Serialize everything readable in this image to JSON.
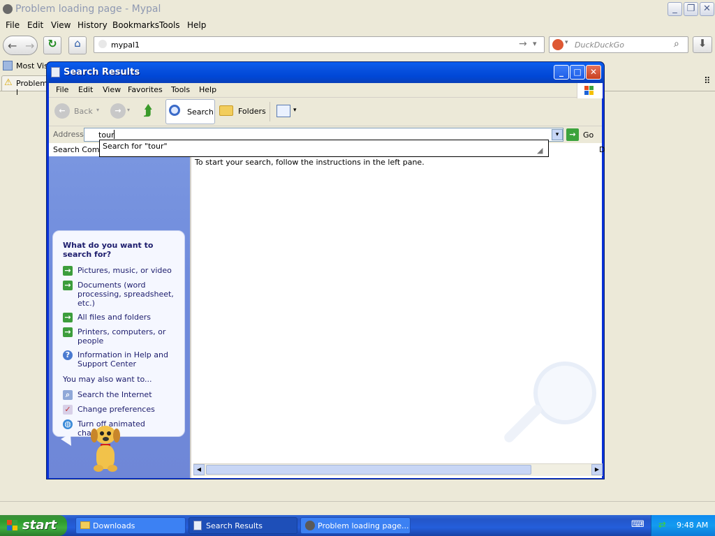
{
  "firefox": {
    "title": "Problem loading page - Mypal",
    "menu": [
      "File",
      "Edit",
      "View",
      "History",
      "Bookmarks",
      "Tools",
      "Help"
    ],
    "url": "mypal1",
    "search_placeholder": "DuckDuckGo",
    "bookmark": "Most Visi",
    "tab": "Problem l"
  },
  "explorer": {
    "title": "Search Results",
    "menu": [
      "File",
      "Edit",
      "View",
      "Favorites",
      "Tools",
      "Help"
    ],
    "toolbar": {
      "back": "Back",
      "search": "Search",
      "folders": "Folders"
    },
    "address_label": "Address",
    "address_value": "tour",
    "go_label": "Go",
    "suggestion": "Search for \"tour\"",
    "left_header": "Search Compa",
    "right_header_stub": "D",
    "instructions": "To start your search, follow the instructions in the left pane.",
    "search_panel": {
      "question": "What do you want to search for?",
      "options": [
        "Pictures, music, or video",
        "Documents (word processing, spreadsheet, etc.)",
        "All files and folders",
        "Printers, computers, or people",
        "Information in Help and Support Center"
      ],
      "also_label": "You may also want to...",
      "also_options": [
        "Search the Internet",
        "Change preferences",
        "Turn off animated character"
      ]
    }
  },
  "taskbar": {
    "start": "start",
    "tasks": [
      "Downloads",
      "Search Results",
      "Problem loading page..."
    ],
    "clock": "9:48 AM"
  }
}
